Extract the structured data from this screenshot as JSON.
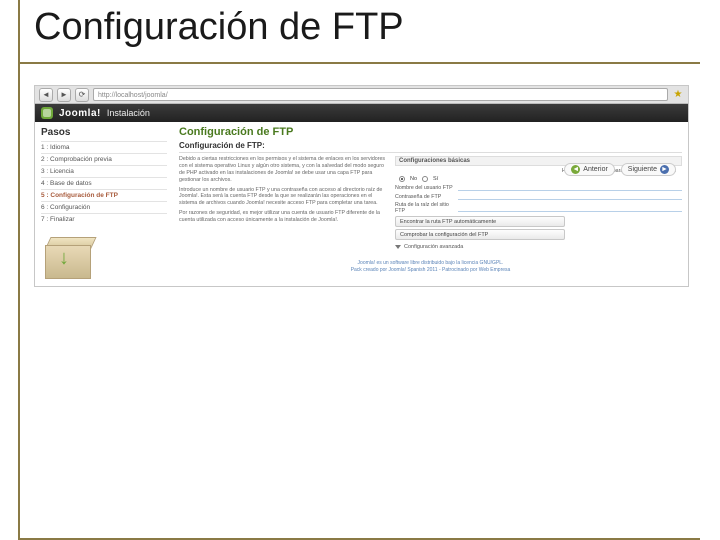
{
  "slide": {
    "title": "Configuración de FTP"
  },
  "browser": {
    "address": "http://localhost/joomla/",
    "back_glyph": "◄",
    "fwd_glyph": "►",
    "reload_glyph": "⟳",
    "star_glyph": "★"
  },
  "joomlabar": {
    "brand": "Joomla!",
    "section": "Instalación"
  },
  "sidebar": {
    "title": "Pasos",
    "steps": [
      "1 : Idioma",
      "2 : Comprobación previa",
      "3 : Licencia",
      "4 : Base de datos",
      "5 : Configuración de FTP",
      "6 : Configuración",
      "7 : Finalizar"
    ],
    "active_index": 4
  },
  "nav": {
    "prev": "Anterior",
    "next": "Siguiente"
  },
  "main": {
    "title": "Configuración de FTP",
    "subtitle": "Configuración de FTP:",
    "desc": [
      "Debido a ciertas restricciones en los permisos y el sistema de enlaces en los servidores con el sistema operativo Linux y algún otro sistema, y con la salvedad del modo seguro de PHP activado en las instalaciones de Joomla! se debe usar una capa FTP para gestionar los archivos.",
      "Introduce un nombre de usuario FTP y una contraseña con acceso al directorio raíz de Joomla!. Esta será la cuenta FTP desde la que se realizarán las operaciones en el sistema de archivos cuando Joomla! necesite acceso FTP para completar una tarea.",
      "Por razones de seguridad, es mejor utilizar una cuenta de usuario FTP diferente de la cuenta utilizada con acceso únicamente a la instalación de Joomla!."
    ]
  },
  "form": {
    "basic_head": "Configuraciones básicas",
    "enable_label": "Habilitar la capa FTP para la gestión de archivos",
    "opt_no": "No",
    "opt_yes": "Sí",
    "user_label": "Nombre del usuario FTP",
    "pass_label": "Contraseña de FTP",
    "root_label": "Ruta de la raíz del sitio FTP",
    "btn_autofind": "Encontrar la ruta FTP automáticamente",
    "btn_verify": "Comprobar la configuración del FTP",
    "advanced_toggle": "Configuración avanzada"
  },
  "footer": {
    "line1": "Joomla! es un software libre distribuido bajo la licencia GNU/GPL.",
    "line2": "Pack creado por Joomla! Spanish 2011 - Patrocinado por Web Empresa"
  }
}
